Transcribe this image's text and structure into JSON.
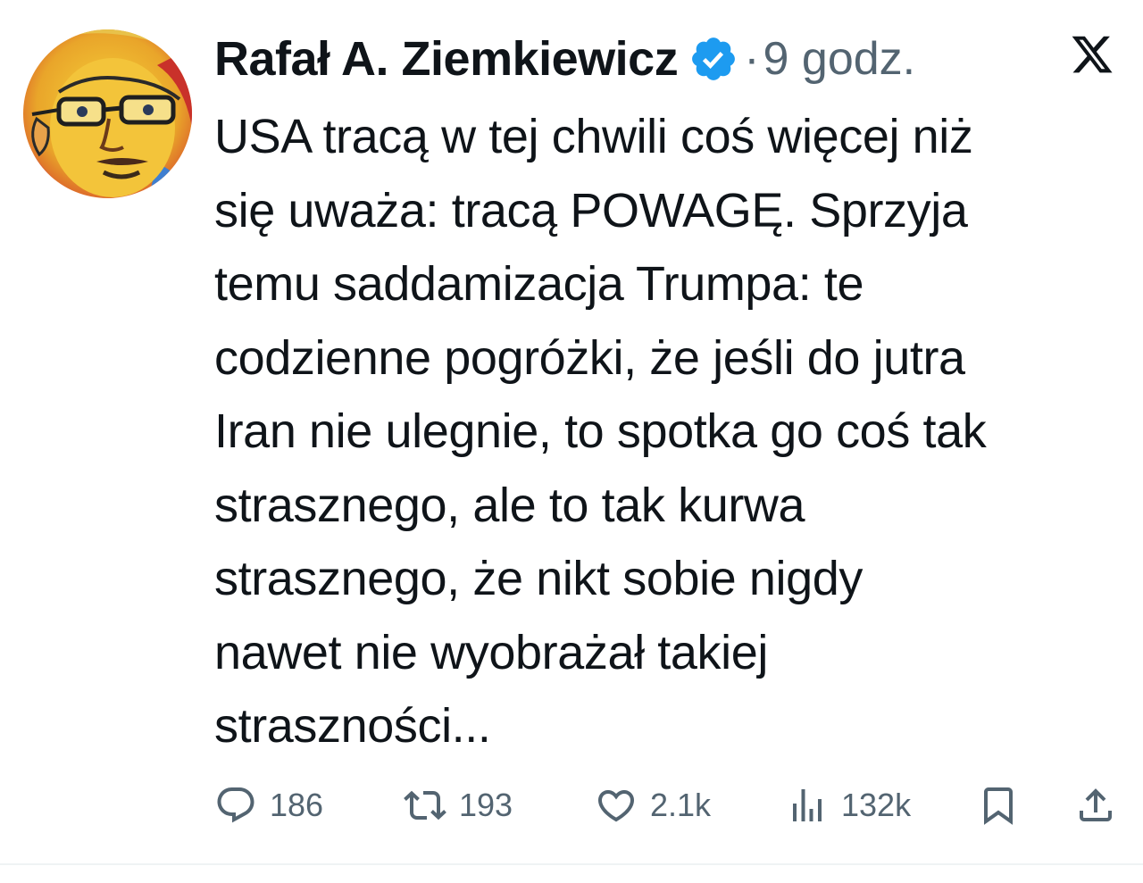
{
  "author": {
    "display_name": "Rafał A. Ziemkiewicz",
    "separator": "·",
    "timestamp": "9 godz."
  },
  "tweet": {
    "text": "USA tracą w tej chwili coś więcej niż\nsię uważa: tracą POWAGĘ. Sprzyja\ntemu saddamizacja Trumpa: te\ncodzienne pogróżki, że jeśli do jutra\nIran nie ulegnie, to spotka go coś tak\nstrasznego, ale to tak kurwa\nstrasznego, że nikt sobie nigdy\nnawet nie wyobrażał takiej\nstraszności..."
  },
  "actions": {
    "replies": "186",
    "reposts": "193",
    "likes": "2.1k",
    "views": "132k"
  },
  "icons": {
    "verified": "verified-badge-icon",
    "brand": "x-logo-icon",
    "reply": "reply-icon",
    "repost": "repost-icon",
    "like": "heart-icon",
    "views": "views-icon",
    "bookmark": "bookmark-icon",
    "share": "share-icon"
  },
  "colors": {
    "text": "#0f1419",
    "secondary": "#536471",
    "verified": "#1d9bf0"
  }
}
